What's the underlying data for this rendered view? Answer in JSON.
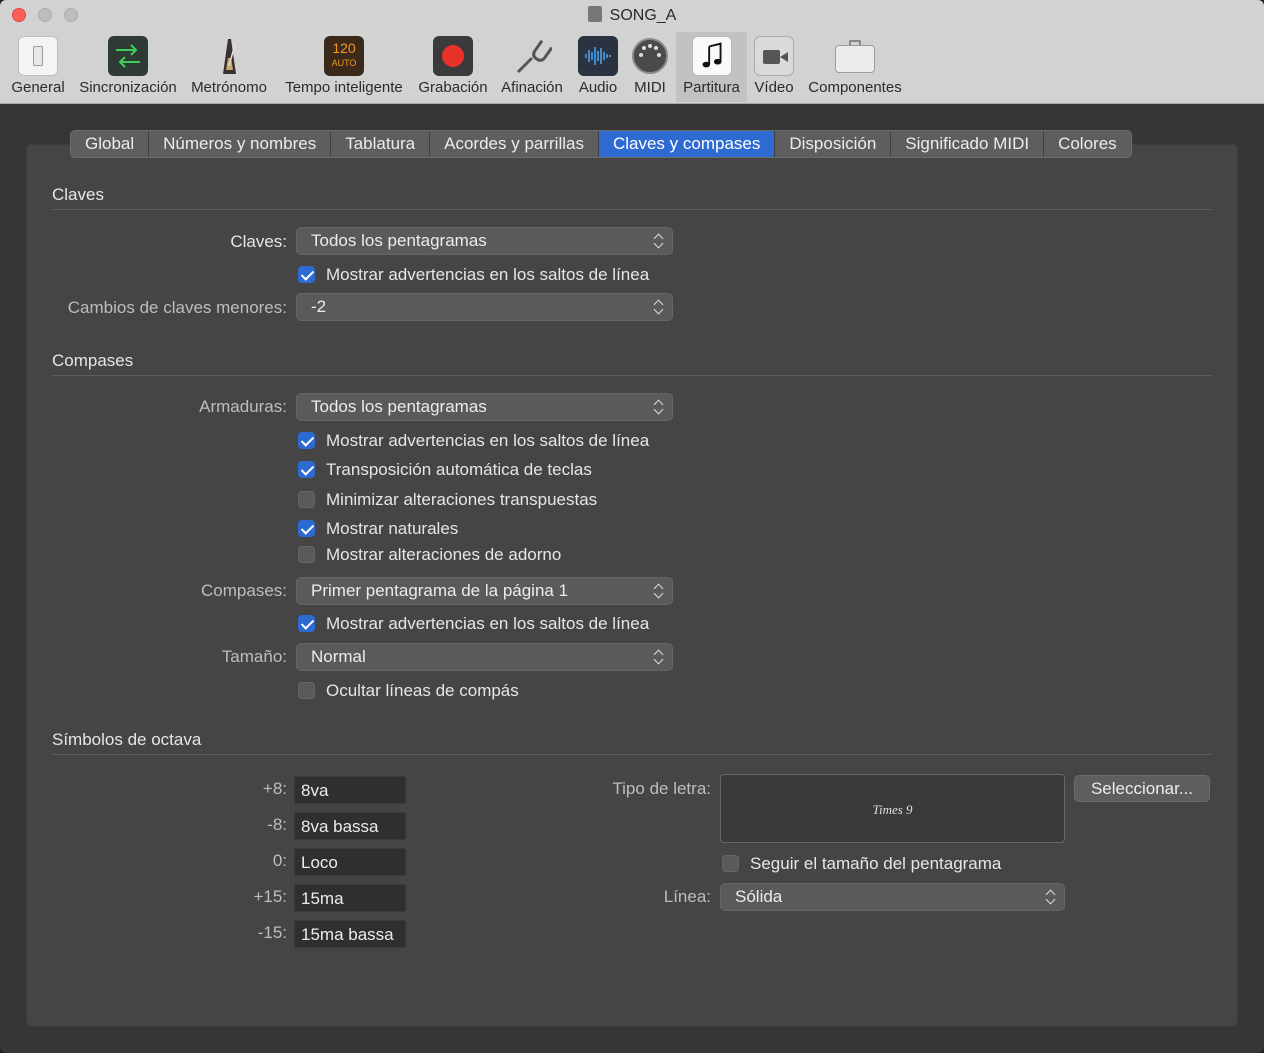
{
  "window": {
    "title": "SONG_A"
  },
  "toolbar": {
    "items": [
      {
        "label": "General",
        "icon": "general-switch-icon"
      },
      {
        "label": "Sincronización",
        "icon": "sync-arrows-icon"
      },
      {
        "label": "Metrónomo",
        "icon": "metronome-icon"
      },
      {
        "label": "Tempo inteligente",
        "icon": "smart-tempo-icon",
        "badge_top": "120",
        "badge_bottom": "AUTO"
      },
      {
        "label": "Grabación",
        "icon": "record-icon"
      },
      {
        "label": "Afinación",
        "icon": "tuning-fork-icon"
      },
      {
        "label": "Audio",
        "icon": "audio-waveform-icon"
      },
      {
        "label": "MIDI",
        "icon": "midi-connector-icon"
      },
      {
        "label": "Partitura",
        "icon": "score-note-icon",
        "active": true
      },
      {
        "label": "Vídeo",
        "icon": "video-camera-icon"
      },
      {
        "label": "Componentes",
        "icon": "components-case-icon"
      }
    ]
  },
  "tabs": [
    {
      "label": "Global"
    },
    {
      "label": "Números y nombres"
    },
    {
      "label": "Tablatura"
    },
    {
      "label": "Acordes y parrillas"
    },
    {
      "label": "Claves y compases",
      "selected": true
    },
    {
      "label": "Disposición"
    },
    {
      "label": "Significado MIDI"
    },
    {
      "label": "Colores"
    }
  ],
  "claves": {
    "title": "Claves",
    "claves_label": "Claves:",
    "claves_value": "Todos los pentagramas",
    "warn_label": "Mostrar advertencias en los saltos de línea",
    "warn_checked": true,
    "minor_label": "Cambios de claves menores:",
    "minor_value": "-2"
  },
  "compases": {
    "title": "Compases",
    "armaduras_label": "Armaduras:",
    "armaduras_value": "Todos los pentagramas",
    "checks": [
      {
        "label": "Mostrar advertencias en los saltos de línea",
        "checked": true
      },
      {
        "label": "Transposición automática de teclas",
        "checked": true
      },
      {
        "label": "Minimizar alteraciones transpuestas",
        "checked": false
      },
      {
        "label": "Mostrar naturales",
        "checked": true
      },
      {
        "label": "Mostrar alteraciones de adorno",
        "checked": false
      }
    ],
    "compases_label": "Compases:",
    "compases_value": "Primer pentagrama de la página 1",
    "warn2_label": "Mostrar advertencias en los saltos de línea",
    "warn2_checked": true,
    "size_label": "Tamaño:",
    "size_value": "Normal",
    "hide_label": "Ocultar líneas de compás",
    "hide_checked": false
  },
  "octava": {
    "title": "Símbolos de octava",
    "fields": [
      {
        "label": "+8:",
        "value": "8va"
      },
      {
        "label": "-8:",
        "value": "8va bassa"
      },
      {
        "label": "0:",
        "value": "Loco"
      },
      {
        "label": "+15:",
        "value": "15ma"
      },
      {
        "label": "-15:",
        "value": "15ma bassa"
      }
    ],
    "font_label": "Tipo de letra:",
    "font_preview": "Times 9",
    "select_button": "Seleccionar...",
    "follow_label": "Seguir el tamaño del pentagrama",
    "follow_checked": false,
    "line_label": "Línea:",
    "line_value": "Sólida"
  },
  "colors": {
    "accent": "#2d6bd2",
    "record": "#e8322c",
    "tempo_badge": "#f39a1e"
  }
}
